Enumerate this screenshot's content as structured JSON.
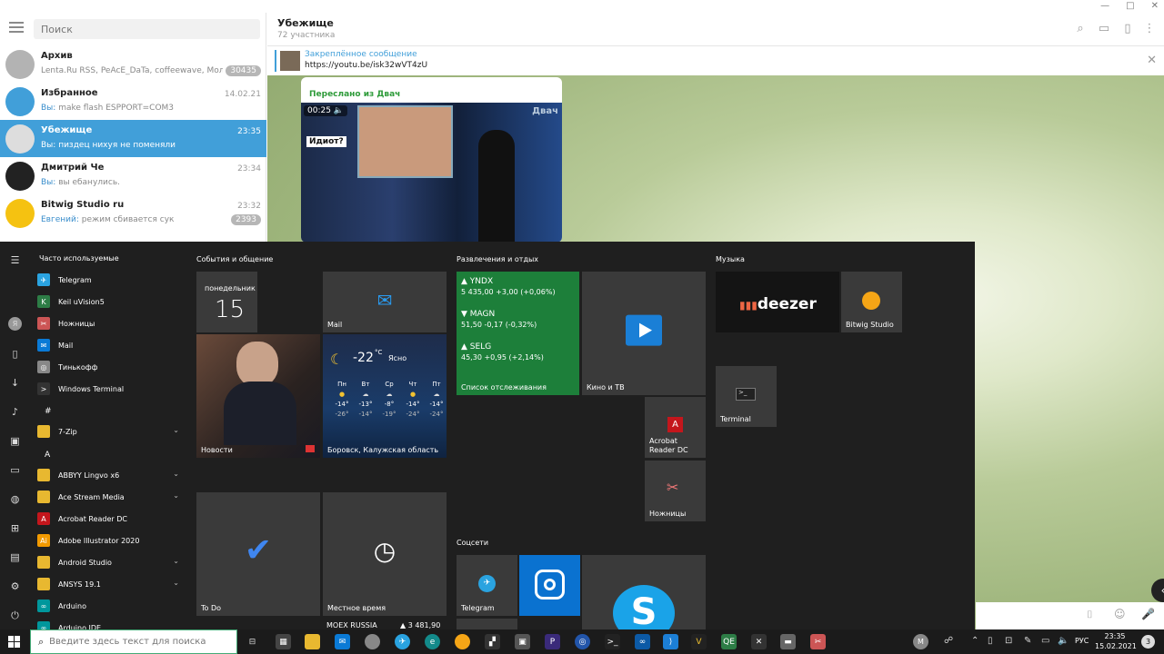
{
  "telegram": {
    "search_placeholder": "Поиск",
    "chats": [
      {
        "name": "Архив",
        "sender": "",
        "preview": "Lenta.Ru RSS, PeAcE_DaTa, coffeewave, Молни...",
        "time": "",
        "badge": "30435",
        "avatar_color": "#b3b3b3",
        "avatar_icon": "archive-icon"
      },
      {
        "name": "Избранное",
        "sender": "Вы:",
        "preview": "make flash ESPPORT=COM3",
        "time": "14.02.21",
        "badge": "",
        "avatar_color": "#419fd9",
        "avatar_icon": "bookmark-icon"
      },
      {
        "name": "Убежище",
        "sender": "Вы:",
        "preview": "пиздец нихуя не поменяли",
        "time": "23:35",
        "badge": "",
        "avatar_color": "#ddd",
        "avatar_icon": "group-avatar"
      },
      {
        "name": "Дмитрий Че",
        "sender": "Вы:",
        "preview": "вы ебанулись.",
        "time": "23:34",
        "badge": "",
        "avatar_color": "#222",
        "avatar_icon": "user-avatar"
      },
      {
        "name": "Bitwig Studio ru",
        "sender": "Евгений:",
        "preview": "режим сбивается сук",
        "time": "23:32",
        "badge": "2393",
        "avatar_color": "#f5c211",
        "avatar_icon": "group-avatar"
      }
    ],
    "header": {
      "title": "Убежище",
      "subtitle": "72 участника"
    },
    "pinned": {
      "title": "Закреплённое сообщение",
      "text": "https://youtu.be/isk32wVT4zU"
    },
    "message": {
      "forwarded": "Переслано из Двач",
      "video_time": "00:25",
      "video_caption": "Идиот?",
      "watermark": "Двач"
    }
  },
  "start": {
    "frequent_title": "Часто используемые",
    "apps": [
      {
        "label": "Telegram",
        "color": "#2aa3e0",
        "glyph": "✈",
        "chev": false
      },
      {
        "label": "Keil uVision5",
        "color": "#2d7d46",
        "glyph": "K",
        "chev": false
      },
      {
        "label": "Ножницы",
        "color": "#c55",
        "glyph": "✂",
        "chev": false
      },
      {
        "label": "Mail",
        "color": "#0a7ad6",
        "glyph": "✉",
        "chev": false
      },
      {
        "label": "Тинькофф",
        "color": "#888",
        "glyph": "◎",
        "chev": false
      },
      {
        "label": "Windows Terminal",
        "color": "#333",
        "glyph": ">",
        "chev": false
      }
    ],
    "letter_hash": "#",
    "app_7zip": "7-Zip",
    "letter_a": "A",
    "apps_a": [
      {
        "label": "ABBYY Lingvo x6",
        "color": "#e8b830",
        "glyph": "",
        "chev": true
      },
      {
        "label": "Ace Stream Media",
        "color": "#e8b830",
        "glyph": "",
        "chev": true
      },
      {
        "label": "Acrobat Reader DC",
        "color": "#c4161c",
        "glyph": "A",
        "chev": false
      },
      {
        "label": "Adobe Illustrator 2020",
        "color": "#f29a00",
        "glyph": "Ai",
        "chev": false
      },
      {
        "label": "Android Studio",
        "color": "#e8b830",
        "glyph": "",
        "chev": true
      },
      {
        "label": "ANSYS 19.1",
        "color": "#e8b830",
        "glyph": "",
        "chev": true
      },
      {
        "label": "Arduino",
        "color": "#00979c",
        "glyph": "∞",
        "chev": false
      },
      {
        "label": "Arduino IDE",
        "color": "#00979c",
        "glyph": "∞",
        "chev": false
      }
    ],
    "sections": {
      "social": "События и общение",
      "fun": "Развлечения и отдых",
      "music": "Музыка",
      "soc": "Соцсети"
    },
    "calendar": {
      "day": "понедельник",
      "date": "15"
    },
    "mail_label": "Mail",
    "news_label": "Новости",
    "weather": {
      "temp": "-22",
      "unit": "°C",
      "cond": "Ясно",
      "location": "Боровск, Калужская область",
      "days": [
        {
          "d": "Пн",
          "hi": "-14°",
          "lo": "-26°"
        },
        {
          "d": "Вт",
          "hi": "-13°",
          "lo": "-14°"
        },
        {
          "d": "Ср",
          "hi": "-8°",
          "lo": "-19°"
        },
        {
          "d": "Чт",
          "hi": "-14°",
          "lo": "-24°"
        },
        {
          "d": "Пт",
          "hi": "-14°",
          "lo": "-24°"
        }
      ]
    },
    "stocks": {
      "label": "Список отслеживания",
      "items": [
        {
          "arrow": "▲",
          "ticker": "YNDX",
          "value": "5 435,00 +3,00 (+0,06%)"
        },
        {
          "arrow": "▼",
          "ticker": "MAGN",
          "value": "51,50 -0,17 (-0,32%)"
        },
        {
          "arrow": "▲",
          "ticker": "SELG",
          "value": "45,30 +0,95 (+2,14%)"
        }
      ]
    },
    "movies_label": "Кино и ТВ",
    "acrobat_label": "Acrobat Reader DC",
    "scissors_label": "Ножницы",
    "deezer_label": "deezer",
    "bitwig_label": "Bitwig Studio",
    "terminal_label": "Terminal",
    "todo_label": "To Do",
    "localtime_label": "Местное время",
    "moex": {
      "name": "MOEX RUSSIA",
      "value": "▲ 3 481,90"
    },
    "telegram_tile": "Telegram"
  },
  "taskbar": {
    "search_placeholder": "Введите здесь текст для поиска",
    "lang": "РУС",
    "time": "23:35",
    "date": "15.02.2021",
    "notifications": "3",
    "user_initial": "M"
  }
}
